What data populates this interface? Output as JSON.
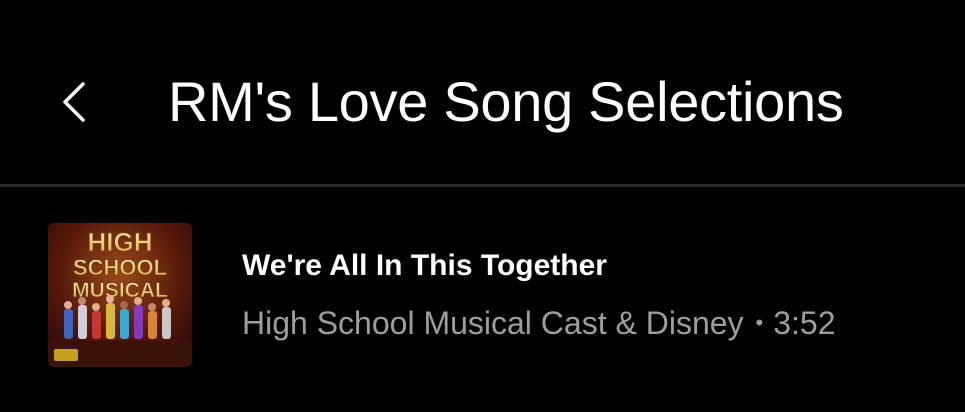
{
  "header": {
    "back_icon": "chevron-left-icon",
    "title": "RM's Love Song Selections"
  },
  "tracks": [
    {
      "title": "We're All In This Together",
      "artist": "High School Musical Cast & Disney",
      "separator": "•",
      "duration": "3:52",
      "artwork_text": [
        "HIGH",
        "SCHOOL",
        "MUSICAL"
      ]
    }
  ],
  "colors": {
    "background": "#000000",
    "title": "#ffffff",
    "secondary_text": "#9e9e9e",
    "divider": "#2a2a2a"
  }
}
